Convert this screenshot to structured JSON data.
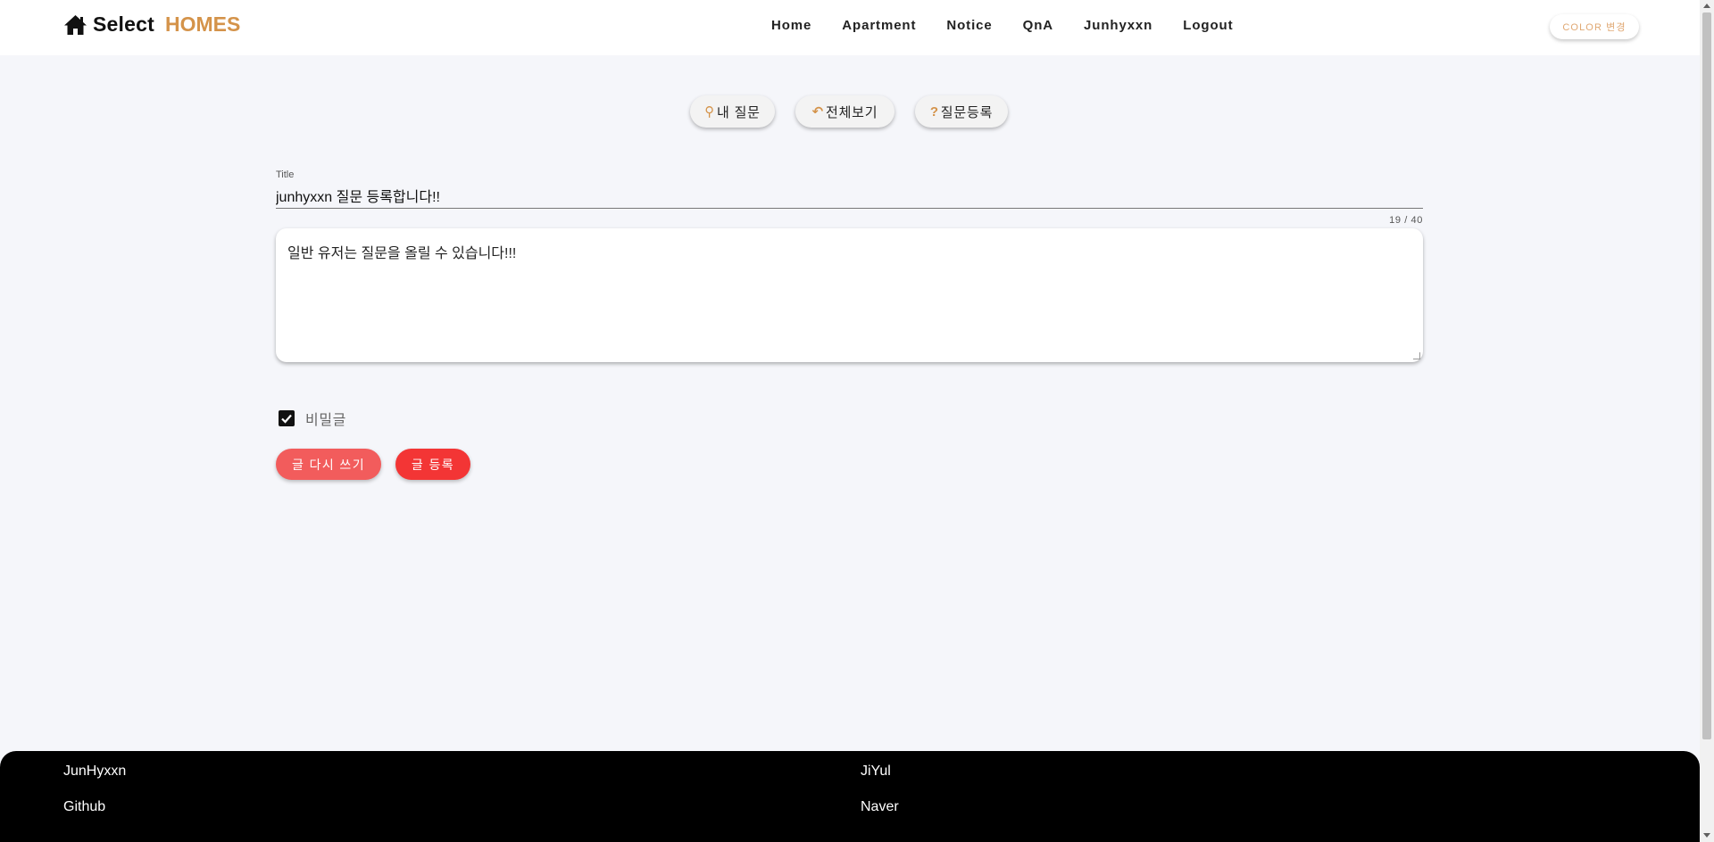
{
  "header": {
    "brand": "Select",
    "brand_accent": "HOMES",
    "nav": [
      "Home",
      "Apartment",
      "Notice",
      "QnA",
      "Junhyxxn",
      "Logout"
    ],
    "color_button": "COLOR 변경"
  },
  "tabs": {
    "my_questions": {
      "icon": "⚲",
      "label": "내 질문"
    },
    "view_all": {
      "icon": "↶",
      "label": "전체보기"
    },
    "register": {
      "icon": "?",
      "label": "질문등록"
    }
  },
  "form": {
    "title_label": "Title",
    "title_value": "junhyxxn 질문 등록합니다!!",
    "counter": "19 / 40",
    "content_value": "일반 유저는 질문을 올릴 수 있습니다!!!",
    "secret_label": "비밀글",
    "secret_checked": true,
    "rewrite_button": "글 다시 쓰기",
    "submit_button": "글 등록"
  },
  "footer": {
    "col1": {
      "name": "JunHyxxn",
      "link": "Github"
    },
    "col2": {
      "name": "JiYul",
      "link": "Naver"
    }
  },
  "colors": {
    "accent": "#d4934a",
    "rewrite": "#f25c5c",
    "submit": "#f33535"
  }
}
